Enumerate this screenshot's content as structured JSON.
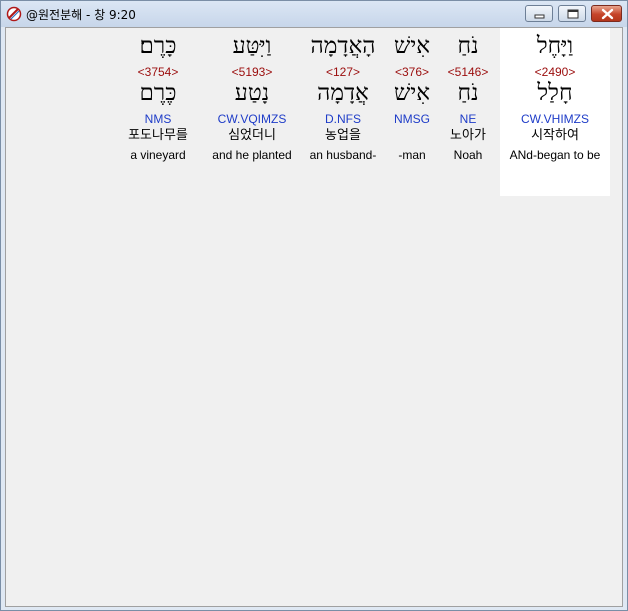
{
  "window": {
    "title": "@원전분해 - 창 9:20",
    "icon": "app-icon",
    "buttons": {
      "minimize": "minimize-icon",
      "maximize": "maximize-icon",
      "close": "close-icon"
    }
  },
  "interlinear": {
    "words": [
      {
        "hebrew": "וַיָּחֶל",
        "strong": "<2490>",
        "lemma": "חָלַל",
        "parsing": "CW.VHIMZS",
        "korean": "시작하여",
        "english": "ANd-began to be",
        "selected": true
      },
      {
        "hebrew": "נֹחַ",
        "strong": "<5146>",
        "lemma": "נֹחַ",
        "parsing": "NE",
        "korean": "노아가",
        "english": "Noah",
        "selected": false
      },
      {
        "hebrew": "אִישׁ",
        "strong": "<376>",
        "lemma": "אִישׁ",
        "parsing": "NMSG",
        "korean": "",
        "english": "-man",
        "selected": false
      },
      {
        "hebrew": "הָאֲדָמָה",
        "strong": "<127>",
        "lemma": "אֲדָמָה",
        "parsing": "D.NFS",
        "korean": "농업을",
        "english": "an husband-",
        "selected": false
      },
      {
        "hebrew": "וַיִּטַּע",
        "strong": "<5193>",
        "lemma": "נָטַע",
        "parsing": "CW.VQIMZS",
        "korean": "심었더니",
        "english": "and he planted",
        "selected": false
      },
      {
        "hebrew": "כָּרֶם׃",
        "strong": "<3754>",
        "lemma": "כֶּרֶם",
        "parsing": "NMS",
        "korean": "포도나무를",
        "english": "a vineyard",
        "selected": false
      }
    ]
  },
  "colors": {
    "strong_number": "#9b0d0d",
    "parsing_code": "#1e3cc8",
    "client_background": "#f0f0f0",
    "selected_background": "#ffffff"
  }
}
